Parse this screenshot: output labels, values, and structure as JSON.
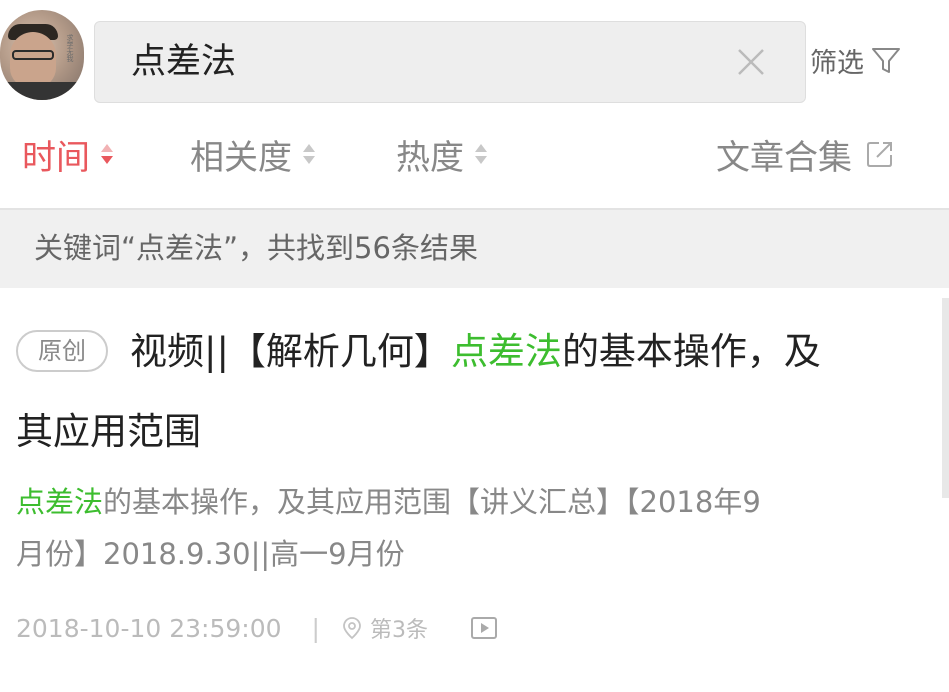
{
  "header": {
    "avatar_seal": "求学无我",
    "search": {
      "query": "点差法"
    },
    "filter_label": "筛选"
  },
  "sort_bar": {
    "items": [
      {
        "label": "时间",
        "active": true
      },
      {
        "label": "相关度",
        "active": false
      },
      {
        "label": "热度",
        "active": false
      }
    ],
    "collection_label": "文章合集"
  },
  "summary": {
    "text": "关键词“点差法”，共找到56条结果"
  },
  "results": [
    {
      "badge": "原创",
      "title_pre": "视频||【解析几何】",
      "title_highlight": "点差法",
      "title_post": "的基本操作，及",
      "title_line2": "其应用范围",
      "desc_highlight": "点差法",
      "desc_post": "的基本操作，及其应用范围【讲义汇总】【2018年9",
      "desc_line2": "月份】2018.9.30||高一9月份",
      "date": "2018-10-10 23:59:00",
      "separator": "|",
      "rank": "第3条"
    }
  ],
  "colors": {
    "accent_red": "#e9585d",
    "highlight_green": "#3dbd2f",
    "summary_bg": "#f0f0f0",
    "search_bg": "#eeeeee"
  },
  "icons": {
    "clear": "close-icon",
    "filter": "funnel-icon",
    "sort": "sort-arrows-icon",
    "export": "share-external-icon",
    "location": "location-pin-icon",
    "video": "video-play-icon"
  }
}
